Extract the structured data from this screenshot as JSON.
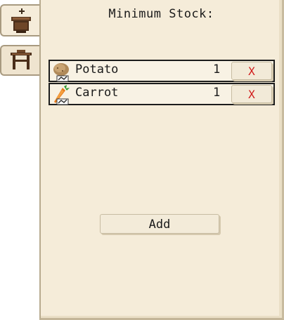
{
  "tabs": [
    {
      "icon": "crafting-pot-icon",
      "active": true
    },
    {
      "icon": "workbench-icon",
      "active": false
    }
  ],
  "panel": {
    "title": "Minimum Stock:",
    "items": [
      {
        "name": "Potato",
        "quantity": "1",
        "remove_label": "X",
        "icon": "potato-icon"
      },
      {
        "name": "Carrot",
        "quantity": "1",
        "remove_label": "X",
        "icon": "carrot-icon"
      }
    ],
    "add_label": "Add"
  },
  "colors": {
    "parchment": "#f5ecd9",
    "border": "#1c1c1c",
    "remove": "#d11a1a"
  }
}
